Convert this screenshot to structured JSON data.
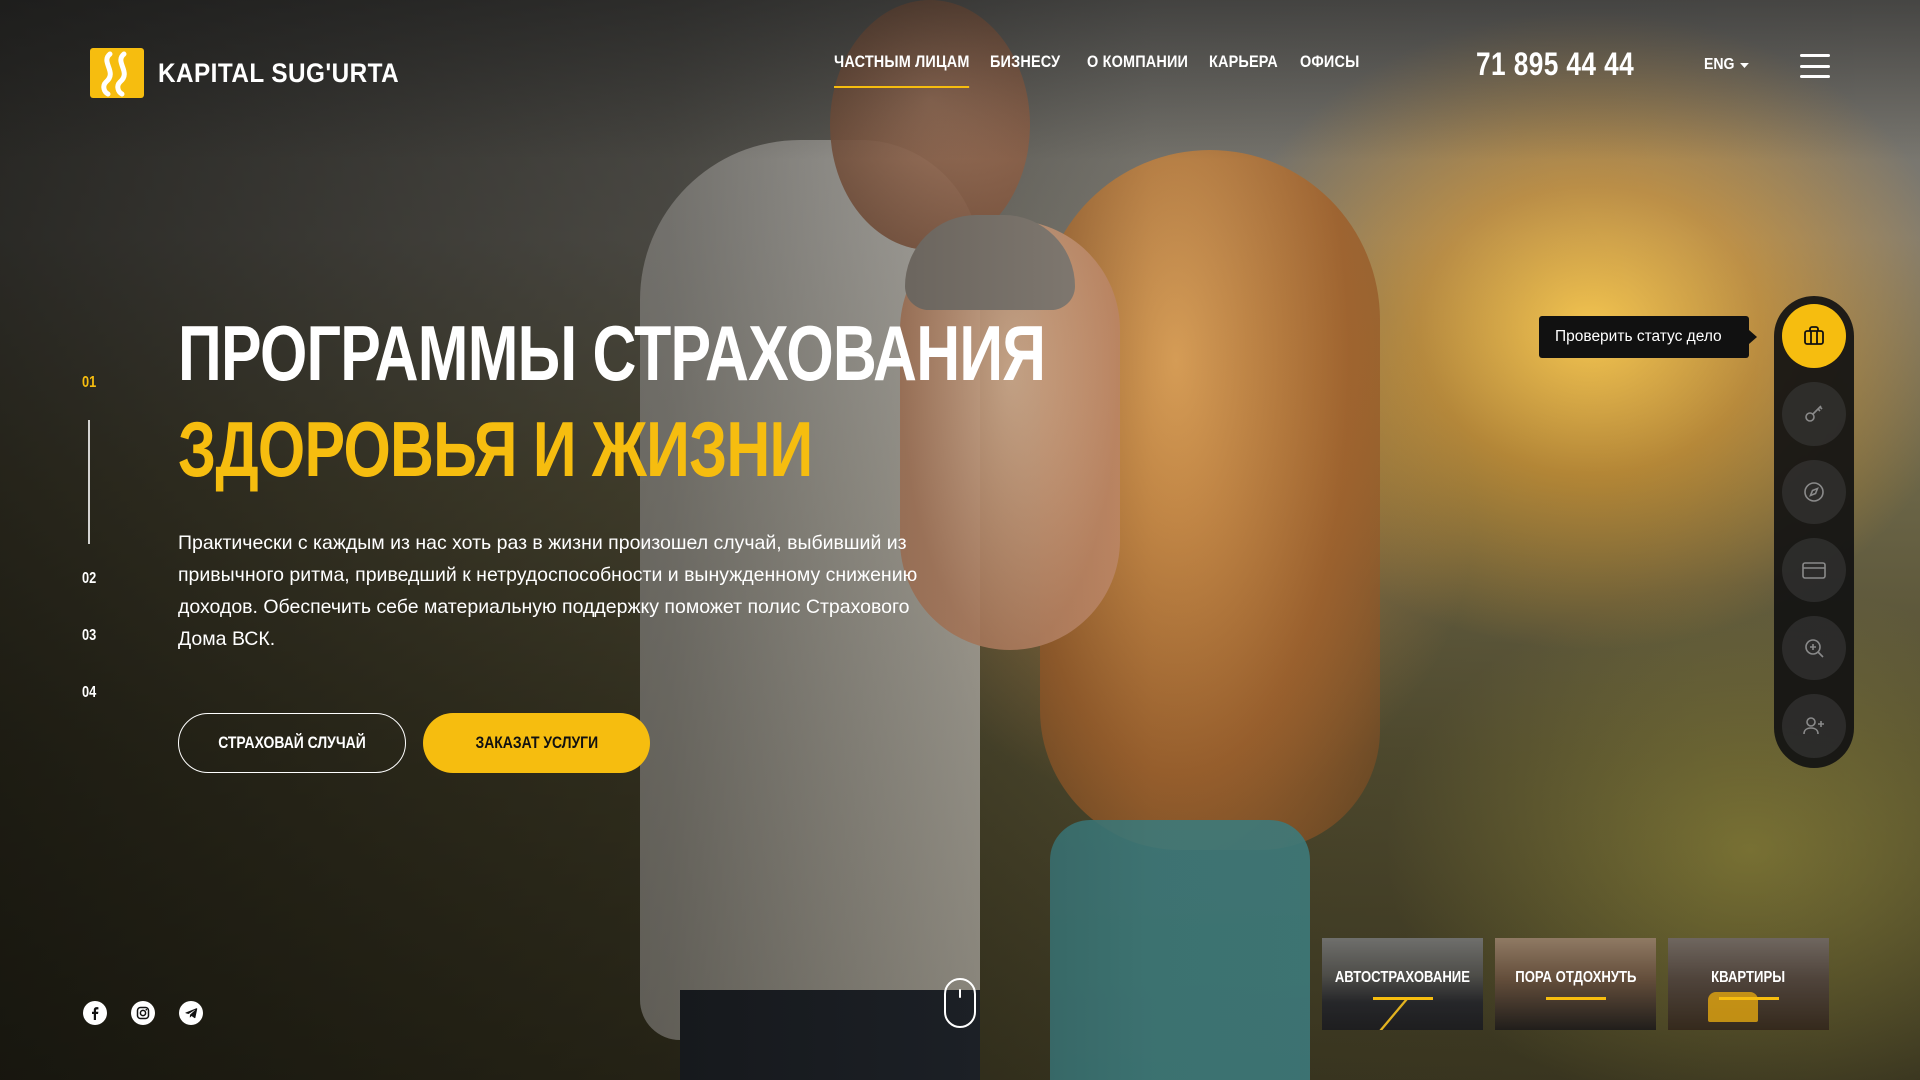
{
  "brand": {
    "name": "KAPITAL SUG'URTA",
    "accent_color": "#f6bd0f"
  },
  "nav": {
    "items": [
      {
        "label": "ЧАСТНЫМ ЛИЦАМ",
        "active": true
      },
      {
        "label": "БИЗНЕСУ",
        "active": false
      },
      {
        "label": "О КОМПАНИИ",
        "active": false
      },
      {
        "label": "КАРЬЕРА",
        "active": false
      },
      {
        "label": "ОФИСЫ",
        "active": false
      }
    ]
  },
  "header": {
    "phone": "71 895 44 44",
    "language": "ENG",
    "menu_icon": "hamburger-menu-icon"
  },
  "slides": {
    "numbers": [
      "01",
      "02",
      "03",
      "04"
    ],
    "active": "01"
  },
  "hero": {
    "title_line1": "ПРОГРАММЫ СТРАХОВАНИЯ",
    "title_line2": "ЗДОРОВЬЯ И ЖИЗНИ",
    "text": "Практически с каждым из нас хоть раз в жизни произошел случай, выбивший из привычного ритма, приведший к нетрудоспособности и вынужденному снижению доходов. Обеспечить себе материальную поддержку поможет полис Страхового Дома ВСК.",
    "btn_secondary": "СТРАХОВАЙ СЛУЧАЙ",
    "btn_primary": "ЗАКАЗАТ УСЛУГИ"
  },
  "social": [
    "facebook-icon",
    "instagram-icon",
    "telegram-icon"
  ],
  "rail": {
    "tooltip": "Проверить статус дело",
    "buttons": [
      "briefcase-icon",
      "key-icon",
      "compass-icon",
      "credit-card-icon",
      "zoom-in-icon",
      "add-user-icon"
    ]
  },
  "cards": [
    {
      "label": "АВТОСТРАХОВАНИЕ"
    },
    {
      "label": "ПОРА ОТДОХНУТЬ"
    },
    {
      "label": "КВАРТИРЫ"
    }
  ]
}
